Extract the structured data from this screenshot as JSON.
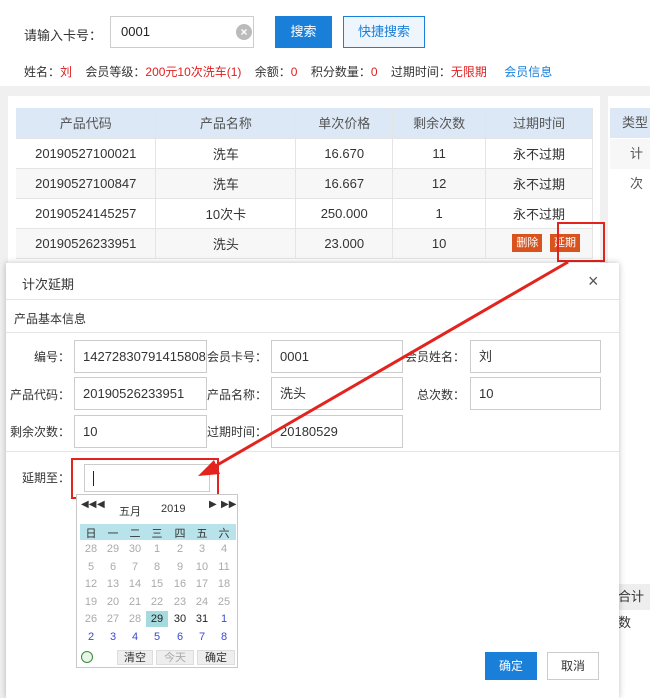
{
  "search": {
    "card_label": "请输入卡号：",
    "card_value": "0001",
    "search_button": "搜索",
    "quick_search_button": "快捷搜索"
  },
  "member_info": {
    "name_key": "姓名：",
    "name_val": "刘",
    "level_key": "会员等级：",
    "level_val": "200元10次洗车(1)",
    "balance_key": "余额：",
    "balance_val": "0",
    "points_key": "积分数量：",
    "points_val": "0",
    "expiry_key": "过期时间：",
    "expiry_val": "无限期",
    "member_link": "会员信息"
  },
  "table": {
    "headers": [
      "产品代码",
      "产品名称",
      "单次价格",
      "剩余次数",
      "过期时间"
    ],
    "rows": [
      [
        "20190527100021",
        "洗车",
        "16.670",
        "11",
        "永不过期"
      ],
      [
        "20190527100847",
        "洗车",
        "16.667",
        "12",
        "永不过期"
      ],
      [
        "20190524145257",
        "10次卡",
        "250.000",
        "1",
        "永不过期"
      ],
      [
        "20190526233951",
        "洗头",
        "23.000",
        "10",
        ""
      ]
    ],
    "delete_button": "删除",
    "extend_button": "延期"
  },
  "right_panel": {
    "header": "类型",
    "cell": "计次",
    "lower_cell": "合计数"
  },
  "modal": {
    "title": "计次延期",
    "close": "×",
    "section_title": "产品基本信息",
    "labels": {
      "id": "编号：",
      "member_card": "会员卡号：",
      "member_name": "会员姓名：",
      "product_code": "产品代码：",
      "product_name": "产品名称：",
      "total_count": "总次数：",
      "remaining": "剩余次数：",
      "expiry": "过期时间：",
      "extend_to": "延期至："
    },
    "values": {
      "id": "14272830791415808",
      "member_card": "0001",
      "member_name": "刘",
      "product_code": "20190526233951",
      "product_name": "洗头",
      "total_count": "10",
      "remaining": "10",
      "expiry": "20180529"
    },
    "ok_button": "确定",
    "cancel_button": "取消"
  },
  "calendar": {
    "month": "五月",
    "year": "2019",
    "weekdays": [
      "日",
      "一",
      "二",
      "三",
      "四",
      "五",
      "六"
    ],
    "weeks": [
      [
        "28",
        "29",
        "30",
        "1",
        "2",
        "3",
        "4"
      ],
      [
        "5",
        "6",
        "7",
        "8",
        "9",
        "10",
        "11"
      ],
      [
        "12",
        "13",
        "14",
        "15",
        "16",
        "17",
        "18"
      ],
      [
        "19",
        "20",
        "21",
        "22",
        "23",
        "24",
        "25"
      ],
      [
        "26",
        "27",
        "28",
        "29",
        "30",
        "31",
        "1"
      ],
      [
        "2",
        "3",
        "4",
        "5",
        "6",
        "7",
        "8"
      ]
    ],
    "selected": "29",
    "clear_button": "清空",
    "today_button": "今天",
    "confirm_button": "确定"
  }
}
